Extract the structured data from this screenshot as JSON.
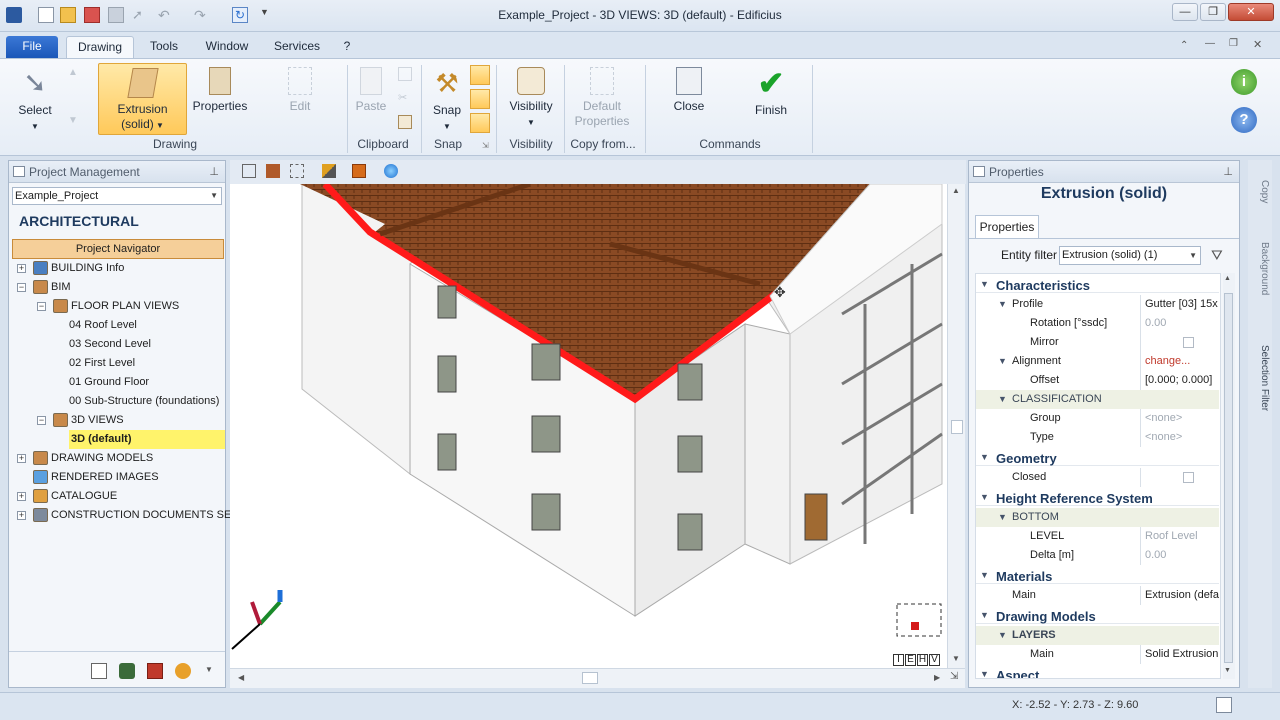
{
  "window": {
    "title": "Example_Project - 3D VIEWS: 3D (default) - Edificius",
    "min": "—",
    "max": "❐",
    "close": "✕"
  },
  "menu": {
    "file": "File",
    "tabs": [
      "Drawing",
      "Tools",
      "Window",
      "Services",
      "?"
    ]
  },
  "ribbon": {
    "buttons": {
      "select": "Select",
      "extrusion": "Extrusion\n(solid)",
      "properties": "Properties",
      "edit": "Edit",
      "paste": "Paste",
      "snap": "Snap",
      "visibility": "Visibility",
      "default_properties": "Default\nProperties",
      "close": "Close",
      "finish": "Finish"
    },
    "groups": {
      "drawing": "Drawing",
      "clipboard": "Clipboard",
      "snap": "Snap",
      "visibility": "Visibility",
      "copy_from": "Copy from...",
      "commands": "Commands"
    }
  },
  "project_panel": {
    "title": "Project Management",
    "project_select": "Example_Project",
    "section": "ARCHITECTURAL",
    "navigator_button": "Project Navigator",
    "tree": [
      {
        "label": "BUILDING Info",
        "level": 0,
        "toggle": "+"
      },
      {
        "label": "BIM",
        "level": 0,
        "toggle": "−"
      },
      {
        "label": "FLOOR PLAN VIEWS",
        "level": 1,
        "toggle": "−"
      },
      {
        "label": "04 Roof Level",
        "level": 2
      },
      {
        "label": "03 Second Level",
        "level": 2
      },
      {
        "label": "02 First Level",
        "level": 2
      },
      {
        "label": "01 Ground Floor",
        "level": 2
      },
      {
        "label": "00 Sub-Structure (foundations)",
        "level": 2
      },
      {
        "label": "3D VIEWS",
        "level": 1,
        "toggle": "−"
      },
      {
        "label": "3D (default)",
        "level": 2,
        "selected": true
      },
      {
        "label": "DRAWING MODELS",
        "level": 0,
        "toggle": "+"
      },
      {
        "label": "RENDERED IMAGES",
        "level": 0
      },
      {
        "label": "CATALOGUE",
        "level": 0,
        "toggle": "+"
      },
      {
        "label": "CONSTRUCTION DOCUMENTS SET",
        "level": 0,
        "toggle": "+"
      }
    ]
  },
  "properties_panel": {
    "title": "Properties",
    "entity_title": "Extrusion (solid)",
    "tab": "Properties",
    "entity_filter_label": "Entity filter",
    "entity_filter_value": "Extrusion (solid) (1)",
    "rows": [
      {
        "kind": "section",
        "label": "Characteristics"
      },
      {
        "kind": "group",
        "label": "Profile",
        "value": "Gutter [03] 15x"
      },
      {
        "kind": "item",
        "label": "Rotation  [°ssdc]",
        "value": "0.00",
        "grey": true
      },
      {
        "kind": "item",
        "label": "Mirror",
        "check": true
      },
      {
        "kind": "group",
        "label": "Alignment",
        "value": "change...",
        "red": true
      },
      {
        "kind": "item",
        "label": "Offset",
        "value": "[0.000; 0.000]"
      },
      {
        "kind": "sub",
        "label": "CLASSIFICATION"
      },
      {
        "kind": "item",
        "label": "Group",
        "value": "<none>",
        "grey": true
      },
      {
        "kind": "item",
        "label": "Type",
        "value": "<none>",
        "grey": true
      },
      {
        "kind": "section",
        "label": "Geometry"
      },
      {
        "kind": "plain",
        "label": "Closed",
        "check": true
      },
      {
        "kind": "section",
        "label": "Height Reference System"
      },
      {
        "kind": "sub",
        "label": "BOTTOM"
      },
      {
        "kind": "item",
        "label": "LEVEL",
        "value": "Roof Level",
        "grey": true
      },
      {
        "kind": "item",
        "label": "Delta  [m]",
        "value": "0.00",
        "grey": true
      },
      {
        "kind": "section",
        "label": "Materials"
      },
      {
        "kind": "plain",
        "label": "Main",
        "value": "Extrusion (defa"
      },
      {
        "kind": "section",
        "label": "Drawing Models"
      },
      {
        "kind": "sub",
        "label": "LAYERS",
        "bold": true
      },
      {
        "kind": "item",
        "label": "Main",
        "value": "Solid Extrusion"
      },
      {
        "kind": "section",
        "label": "Aspect"
      }
    ]
  },
  "side_tabs": [
    "Copy",
    "Background",
    "Selection Filter"
  ],
  "viewport": {
    "viewcube_labels": [
      "I",
      "E",
      "H",
      "V"
    ]
  },
  "status": {
    "coords": "X: -2.52 - Y: 2.73 - Z: 9.60"
  },
  "colors": {
    "accent": "#1b57b8",
    "selection": "#ff1a1a",
    "selected_row": "#fff36b",
    "highlight": "#ffc95a"
  }
}
